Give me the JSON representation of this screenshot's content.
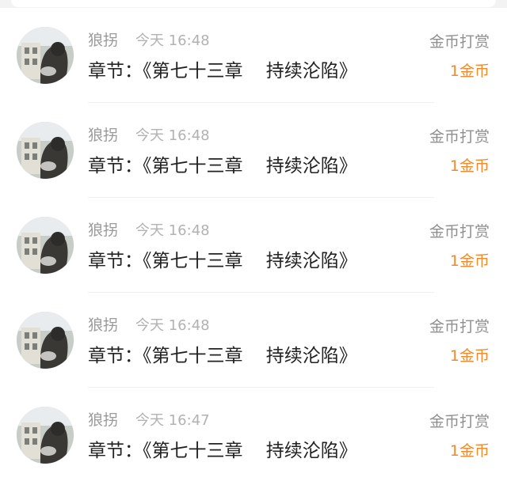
{
  "records": [
    {
      "user": "狼拐",
      "time": "今天 16:48",
      "chapter": "章节：《第七十三章    持续沦陷》",
      "gift_type": "金币打赏",
      "gift_amount": "1金币"
    },
    {
      "user": "狼拐",
      "time": "今天 16:48",
      "chapter": "章节：《第七十三章    持续沦陷》",
      "gift_type": "金币打赏",
      "gift_amount": "1金币"
    },
    {
      "user": "狼拐",
      "time": "今天 16:48",
      "chapter": "章节：《第七十三章    持续沦陷》",
      "gift_type": "金币打赏",
      "gift_amount": "1金币"
    },
    {
      "user": "狼拐",
      "time": "今天 16:48",
      "chapter": "章节：《第七十三章    持续沦陷》",
      "gift_type": "金币打赏",
      "gift_amount": "1金币"
    },
    {
      "user": "狼拐",
      "time": "今天 16:47",
      "chapter": "章节：《第七十三章    持续沦陷》",
      "gift_type": "金币打赏",
      "gift_amount": "1金币"
    }
  ],
  "colors": {
    "accent": "#f08a2c",
    "muted_text": "#9a9a9a",
    "primary_text": "#222222"
  },
  "icons": {
    "avatar": "user-avatar-photo-icon"
  }
}
